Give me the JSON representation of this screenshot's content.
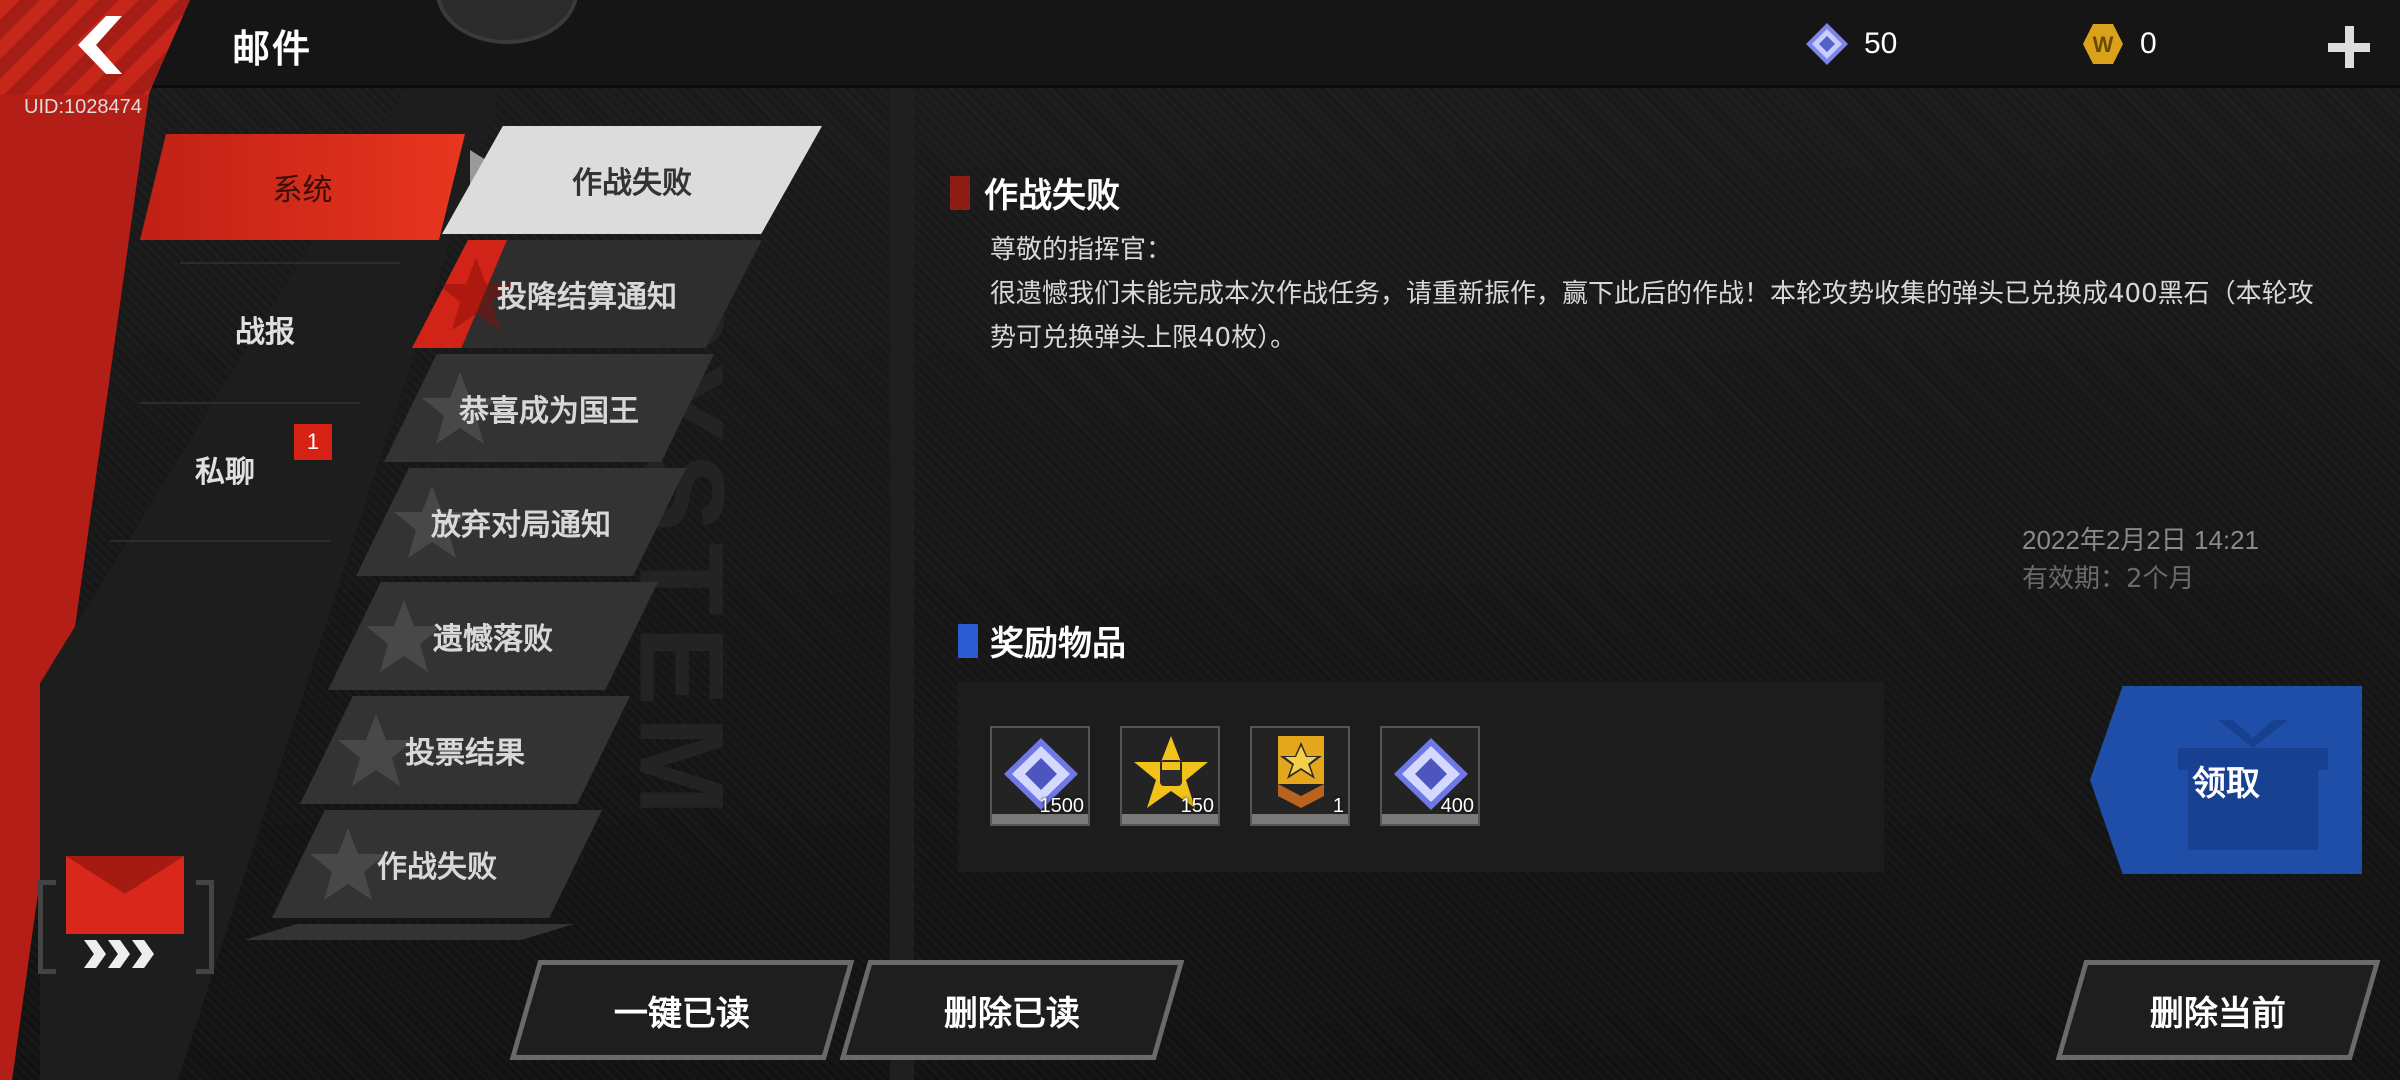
{
  "header": {
    "title": "邮件",
    "uid": "UID:1028474",
    "currencies": [
      {
        "icon": "crystal-icon",
        "value": "50"
      },
      {
        "icon": "gold-w-coin-icon",
        "value": "0"
      }
    ]
  },
  "categories": [
    {
      "label": "系统",
      "active": true
    },
    {
      "label": "战报",
      "active": false
    },
    {
      "label": "私聊",
      "active": false,
      "badge": "1"
    }
  ],
  "mails": [
    {
      "label": "作战失败",
      "active": true
    },
    {
      "label": "投降结算通知"
    },
    {
      "label": "恭喜成为国王"
    },
    {
      "label": "放弃对局通知"
    },
    {
      "label": "遗憾落败"
    },
    {
      "label": "投票结果"
    },
    {
      "label": "作战失败"
    }
  ],
  "message": {
    "title": "作战失败",
    "greeting": "尊敬的指挥官：",
    "body": "很遗憾我们未能完成本次作战任务，请重新振作，赢下此后的作战！本轮攻势收集的弹头已兑换成400黑石（本轮攻势可兑换弹头上限40枚）。",
    "date": "2022年2月2日  14:21",
    "validity": "有效期：2个月"
  },
  "rewards": {
    "title": "奖励物品",
    "items": [
      {
        "icon": "blue-crystal-icon",
        "qty": "1500"
      },
      {
        "icon": "gold-fist-star-icon",
        "qty": "150"
      },
      {
        "icon": "star-medal-icon",
        "qty": "1"
      },
      {
        "icon": "blue-crystal-icon",
        "qty": "400"
      }
    ],
    "claim_label": "领取"
  },
  "actions": {
    "read_all": "一键已读",
    "delete_read": "删除已读",
    "delete_current": "删除当前"
  },
  "colors": {
    "accent_red": "#d12317",
    "claim_blue": "#1f4ea9",
    "reward_bar_blue": "#2a5bd0"
  }
}
